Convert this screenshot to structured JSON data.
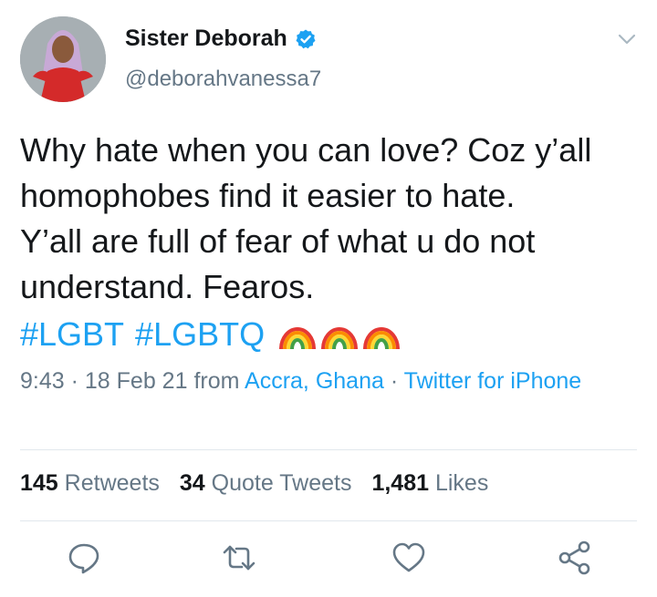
{
  "author": {
    "name": "Sister Deborah",
    "handle": "@deborahvanessa7",
    "verified": true,
    "avatar": "profile-photo"
  },
  "tweet": {
    "lines": [
      "Why hate when you can love? Coz y’all",
      "homophobes find it easier to hate.",
      "Y’all are full of fear of what u do not",
      "understand. Fearos."
    ],
    "hashtags": [
      "#LGBT",
      "#LGBTQ"
    ],
    "emoji": [
      "rainbow-emoji",
      "rainbow-emoji",
      "rainbow-emoji"
    ]
  },
  "meta": {
    "time": "9:43",
    "date": "18 Feb 21",
    "from_word": "from",
    "location": "Accra, Ghana",
    "source": "Twitter for iPhone"
  },
  "stats": {
    "retweets_count": "145",
    "retweets_label": "Retweets",
    "quote_count": "34",
    "quote_label": "Quote Tweets",
    "likes_count": "1,481",
    "likes_label": "Likes"
  },
  "icons": {
    "more": "chevron-down-icon",
    "reply": "reply-icon",
    "retweet": "retweet-icon",
    "like": "heart-icon",
    "share": "share-icon"
  },
  "colors": {
    "link": "#1da1f2",
    "secondary": "#657786",
    "primary_text": "#14171a",
    "divider": "#e1e8ed"
  }
}
